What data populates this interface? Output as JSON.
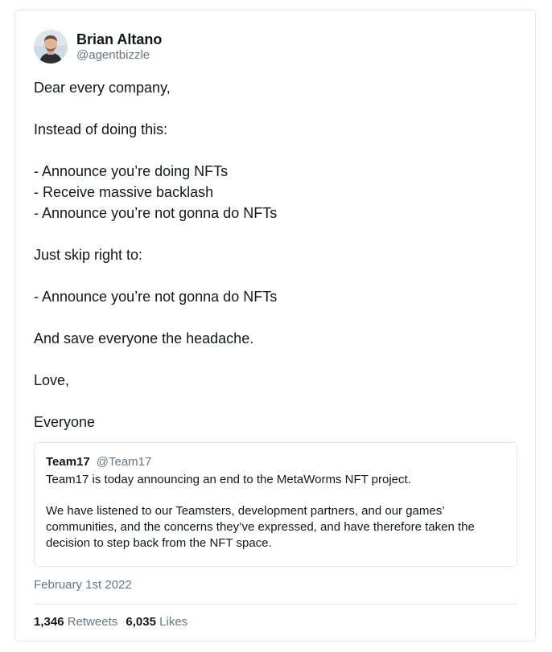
{
  "tweet": {
    "author": {
      "name": "Brian Altano",
      "handle": "@agentbizzle",
      "avatar_icon": "user-avatar-photo"
    },
    "lines": [
      "Dear every company,",
      "",
      "Instead of doing this:",
      "",
      "- Announce you’re doing NFTs",
      "- Receive massive backlash",
      "- Announce you’re not gonna do NFTs",
      "",
      "Just skip right to:",
      "",
      "- Announce you’re not gonna do NFTs",
      "",
      "And save everyone the headache.",
      "",
      "Love,",
      "",
      "Everyone"
    ],
    "quote": {
      "name": "Team17",
      "handle": "@Team17",
      "line1": "Team17 is today announcing an end to the MetaWorms NFT project.",
      "para2": "We have listened to our Teamsters, development partners, and our games’ communities, and the concerns they’ve expressed, and have therefore taken the decision to step back from the NFT space."
    },
    "date": "February 1st 2022",
    "stats": {
      "retweets_count": "1,346",
      "retweets_label": "Retweets",
      "likes_count": "6,035",
      "likes_label": "Likes"
    }
  },
  "colors": {
    "text": "#14171a",
    "muted": "#657786",
    "border": "#e1e8ed"
  }
}
